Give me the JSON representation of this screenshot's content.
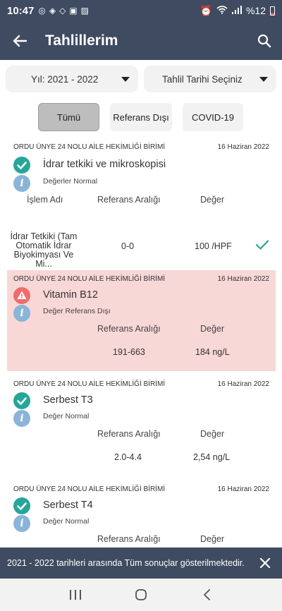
{
  "status_bar": {
    "time": "10:47",
    "battery": "%12"
  },
  "app_bar": {
    "title": "Tahlillerim"
  },
  "filters": {
    "year": "Yıl: 2021 - 2022",
    "date": "Tahlil Tarihi Seçiniz"
  },
  "chips": {
    "all": "Tümü",
    "out_of_ref": "Referans Dışı",
    "covid": "COVID-19"
  },
  "cards": [
    {
      "institution": "ORDU ÜNYE 24 NOLU AİLE HEKİMLİĞİ BİRİMİ",
      "date": "16 Haziran 2022",
      "test": "İdrar tetkiki ve mikroskopisi",
      "sub": "Değerler Normal",
      "headers": {
        "name": "İşlem Adı",
        "range": "Referans Aralığı",
        "value": "Değer"
      },
      "row": {
        "name": "İdrar Tetkiki (Tam Otomatik İdrar Biyokimyası Ve Mi...",
        "range": "0-0",
        "value": "100 /HPF"
      }
    },
    {
      "institution": "ORDU ÜNYE 24 NOLU AİLE HEKİMLİĞİ BİRİMİ",
      "date": "16 Haziran 2022",
      "test": "Vitamin B12",
      "sub": "Değer Referans Dışı",
      "headers": {
        "range": "Referans Aralığı",
        "value": "Değer"
      },
      "row": {
        "range": "191-663",
        "value": "184 ng/L"
      }
    },
    {
      "institution": "ORDU ÜNYE 24 NOLU AİLE HEKİMLİĞİ BİRİMİ",
      "date": "16 Haziran 2022",
      "test": "Serbest T3",
      "sub": "Değer Normal",
      "headers": {
        "range": "Referans Aralığı",
        "value": "Değer"
      },
      "row": {
        "range": "2.0-4.4",
        "value": "2,54 ng/L"
      }
    },
    {
      "institution": "ORDU ÜNYE 24 NOLU AİLE HEKİMLİĞİ BİRİMİ",
      "date": "16 Haziran 2022",
      "test": "Serbest T4",
      "sub": "Değer Normal",
      "headers": {
        "range": "Referans Aralığı",
        "value": "Değer"
      }
    }
  ],
  "snackbar": {
    "text": "2021 - 2022 tarihleri arasında Tüm sonuçlar gösterilmektedir."
  },
  "colors": {
    "primary": "#3f4b60",
    "ok": "#26a69a",
    "warning": "#ef6c6c",
    "ref_bg": "#f8d7d7",
    "info": "#8ab4d8"
  }
}
